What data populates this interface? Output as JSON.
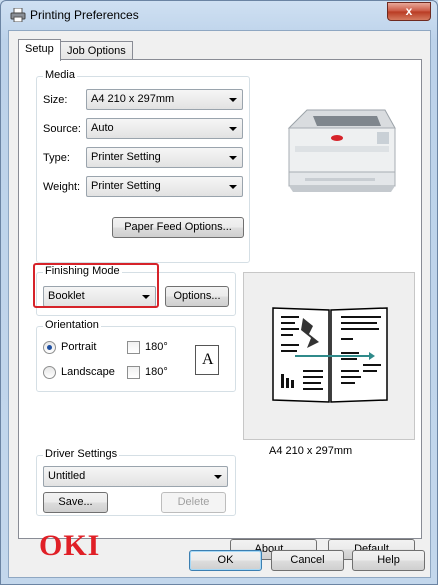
{
  "window": {
    "title": "Printing Preferences",
    "close_glyph": "x"
  },
  "tabs": [
    {
      "label": "Setup",
      "active": true
    },
    {
      "label": "Job Options",
      "active": false
    }
  ],
  "media": {
    "title": "Media",
    "size_label": "Size:",
    "size_value": "A4 210 x 297mm",
    "source_label": "Source:",
    "source_value": "Auto",
    "type_label": "Type:",
    "type_value": "Printer Setting",
    "weight_label": "Weight:",
    "weight_value": "Printer Setting",
    "paper_feed_button": "Paper Feed Options..."
  },
  "finishing": {
    "title": "Finishing Mode",
    "value": "Booklet",
    "options_button": "Options..."
  },
  "orientation": {
    "title": "Orientation",
    "portrait_label": "Portrait",
    "portrait_selected": true,
    "landscape_label": "Landscape",
    "landscape_selected": false,
    "rotate_label_1": "180°",
    "rotate_label_2": "180°",
    "page_glyph": "A"
  },
  "preview": {
    "paper_size": "A4 210 x 297mm"
  },
  "driver_settings": {
    "title": "Driver Settings",
    "value": "Untitled",
    "save_button": "Save...",
    "delete_button": "Delete"
  },
  "brand": {
    "logo_text": "OKI",
    "color": "#e01f26"
  },
  "buttons": {
    "about": "About...",
    "default": "Default",
    "ok": "OK",
    "cancel": "Cancel",
    "help": "Help"
  },
  "colors": {
    "highlight": "#d6232a",
    "accent": "#1f4fa0"
  }
}
